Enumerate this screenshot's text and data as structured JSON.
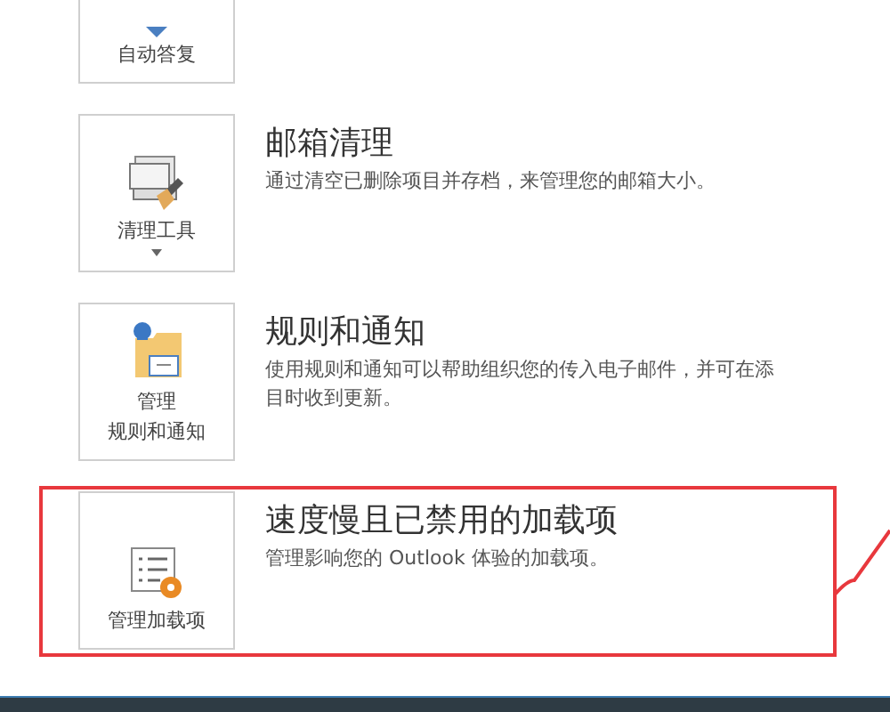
{
  "tools": [
    {
      "label": [
        "自动答复"
      ],
      "dropdown": false
    },
    {
      "label": [
        "清理工具"
      ],
      "dropdown": true,
      "title": "邮箱清理",
      "description": "通过清空已删除项目并存档，来管理您的邮箱大小。"
    },
    {
      "label": [
        "管理",
        "规则和通知"
      ],
      "dropdown": false,
      "title": "规则和通知",
      "description": "使用规则和通知可以帮助组织您的传入电子邮件，并可在添",
      "description_2": "目时收到更新。"
    },
    {
      "label": [
        "管理加载项"
      ],
      "dropdown": false,
      "highlighted": true,
      "title": "速度慢且已禁用的加载项",
      "description": "管理影响您的 Outlook 体验的加载项。"
    }
  ]
}
